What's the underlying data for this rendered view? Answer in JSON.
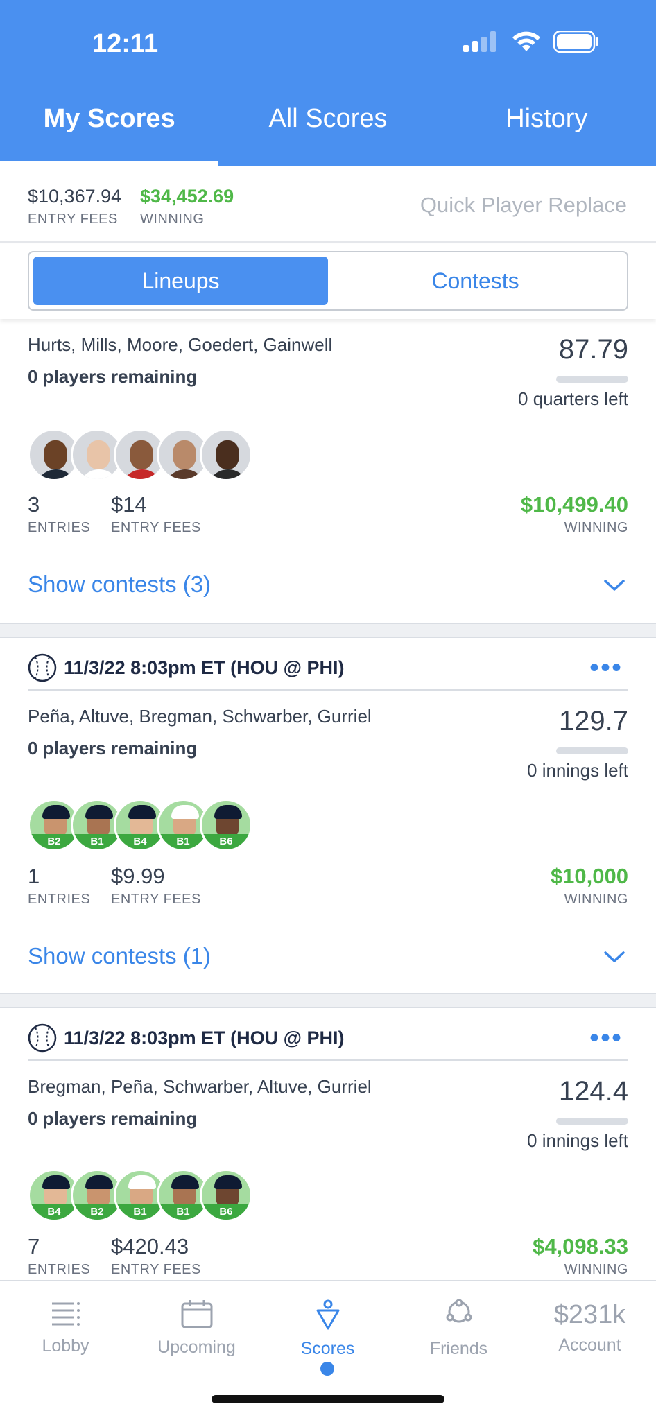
{
  "status_bar": {
    "time": "12:11"
  },
  "tabs": [
    {
      "label": "My Scores",
      "active": true
    },
    {
      "label": "All Scores",
      "active": false
    },
    {
      "label": "History",
      "active": false
    }
  ],
  "summary": {
    "entry_fees_value": "$10,367.94",
    "entry_fees_label": "ENTRY FEES",
    "winning_value": "$34,452.69",
    "winning_label": "WINNING",
    "quick_replace": "Quick Player Replace"
  },
  "segment": {
    "left": "Lineups",
    "right": "Contests",
    "active": "Lineups"
  },
  "cards": [
    {
      "names": "Hurts, Mills, Moore, Goedert, Gainwell",
      "remaining": "0 players remaining",
      "score": "87.79",
      "time_left": "0 quarters left",
      "entries_value": "3",
      "entries_label": "ENTRIES",
      "fees_value": "$14",
      "fees_label": "ENTRY FEES",
      "winning_value": "$10,499.40",
      "winning_label": "WINNING",
      "show_contests": "Show contests (3)"
    },
    {
      "game": "11/3/22 8:03pm ET (HOU @ PHI)",
      "names": "Peña, Altuve, Bregman, Schwarber, Gurriel",
      "remaining": "0 players remaining",
      "score": "129.7",
      "time_left": "0 innings left",
      "positions": [
        "B2",
        "B1",
        "B4",
        "B1",
        "B6"
      ],
      "entries_value": "1",
      "entries_label": "ENTRIES",
      "fees_value": "$9.99",
      "fees_label": "ENTRY FEES",
      "winning_value": "$10,000",
      "winning_label": "WINNING",
      "show_contests": "Show contests (1)"
    },
    {
      "game": "11/3/22 8:03pm ET (HOU @ PHI)",
      "names": "Bregman, Peña, Schwarber, Altuve, Gurriel",
      "remaining": "0 players remaining",
      "score": "124.4",
      "time_left": "0 innings left",
      "positions": [
        "B4",
        "B2",
        "B1",
        "B1",
        "B6"
      ],
      "entries_value": "7",
      "entries_label": "ENTRIES",
      "fees_value": "$420.43",
      "fees_label": "ENTRY FEES",
      "winning_value": "$4,098.33",
      "winning_label": "WINNING"
    }
  ],
  "bottom_nav": [
    {
      "label": "Lobby",
      "icon": "list-icon"
    },
    {
      "label": "Upcoming",
      "icon": "calendar-icon"
    },
    {
      "label": "Scores",
      "icon": "scores-icon",
      "active": true
    },
    {
      "label": "Friends",
      "icon": "friends-icon"
    },
    {
      "label": "Account",
      "value": "$231k"
    }
  ],
  "colors": {
    "brand": "#4a90f0",
    "link": "#3a86e8",
    "green": "#4fb848"
  }
}
